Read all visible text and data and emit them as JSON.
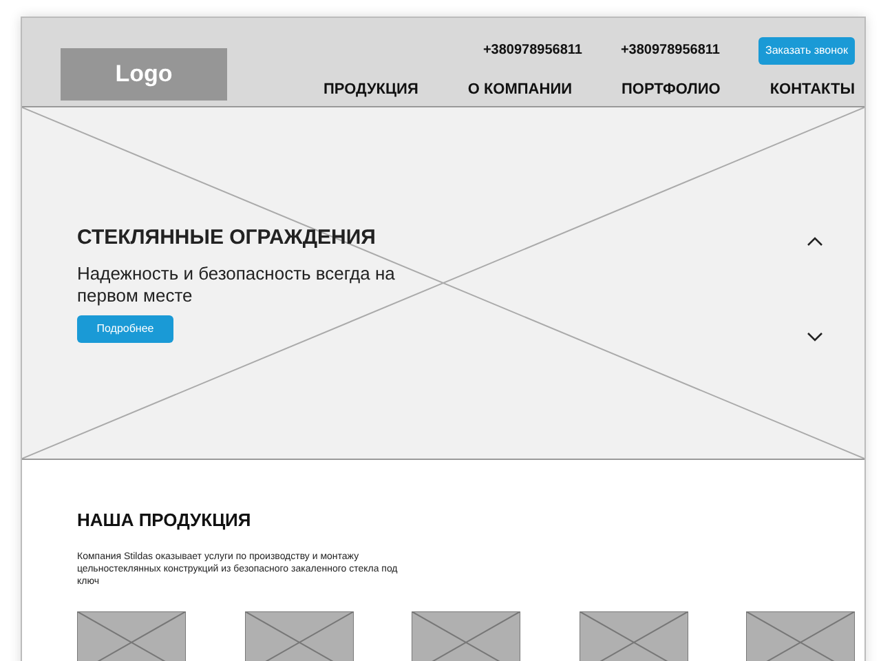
{
  "header": {
    "logo": "Logo",
    "phones": [
      "+380978956811",
      "+380978956811"
    ],
    "callback_button": "Заказать звонок",
    "nav": [
      {
        "label": "ПРОДУКЦИЯ"
      },
      {
        "label": "О КОМПАНИИ"
      },
      {
        "label": "ПОРТФОЛИО"
      },
      {
        "label": "КОНТАКТЫ"
      }
    ]
  },
  "hero": {
    "title": "СТЕКЛЯННЫЕ ОГРАЖДЕНИЯ",
    "subtitle": "Надежность и безопасность всегда на первом месте",
    "button": "Подробнее"
  },
  "products": {
    "title": "НАША ПРОДУКЦИЯ",
    "description": "Компания Stildas  оказывает услуги по производству и монтажу цельностеклянных конструкций из безопасного закаленного стекла под ключ",
    "items": [
      {
        "kind": "image"
      },
      {
        "kind": "image"
      },
      {
        "kind": "image"
      },
      {
        "kind": "image"
      },
      {
        "kind": "image"
      }
    ]
  }
}
